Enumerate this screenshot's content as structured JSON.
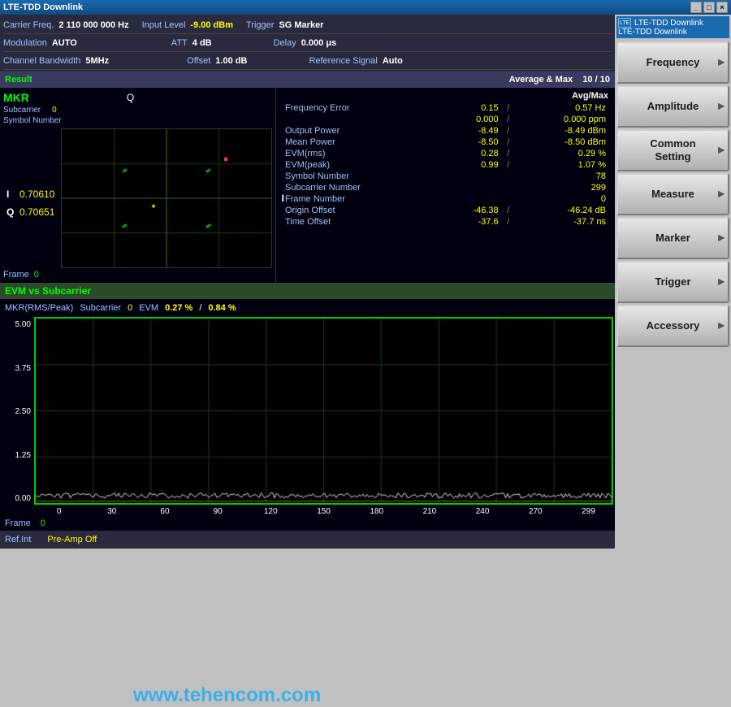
{
  "titlebar": {
    "title": "LTE-TDD Downlink",
    "controls": [
      "_",
      "□",
      "×"
    ]
  },
  "header": {
    "row1": {
      "carrier_freq_label": "Carrier Freq.",
      "carrier_freq_value": "2 110 000 000 Hz",
      "input_level_label": "Input Level",
      "input_level_value": "-9.00 dBm",
      "trigger_label": "Trigger",
      "trigger_value": "SG Marker"
    },
    "row2": {
      "modulation_label": "Modulation",
      "modulation_value": "AUTO",
      "att_label": "ATT",
      "att_value": "4 dB",
      "delay_label": "Delay",
      "delay_value": "0.000 μs"
    },
    "row3": {
      "channel_bw_label": "Channel Bandwidth",
      "channel_bw_value": "5MHz",
      "offset_label": "Offset",
      "offset_value": "1.00 dB",
      "ref_signal_label": "Reference Signal",
      "ref_signal_value": "Auto"
    }
  },
  "result_bar": {
    "left": "Result",
    "avg_max_label": "Average & Max",
    "avg_max_val1": "10",
    "avg_max_sep": "/",
    "avg_max_val2": "10"
  },
  "mkr": {
    "title": "MKR",
    "q_label": "Q",
    "subcarrier_label": "Subcarrier",
    "subcarrier_val": "0",
    "symbol_number_label": "Symbol Number",
    "i_label": "I",
    "i_val": "0.70610",
    "q_label2": "Q",
    "q_val": "0.70651",
    "i_right": "I",
    "frame_label": "Frame",
    "frame_val": "0"
  },
  "measurements": {
    "avg_max_col": "Avg/Max",
    "frequency_error": {
      "label": "Frequency Error",
      "val1": "0.15",
      "sep": "/",
      "val2": "0.57 Hz",
      "val3": "0.000",
      "val4": "0.000 ppm"
    },
    "output_power": {
      "label": "Output Power",
      "val1": "-8.49",
      "sep": "/",
      "val2": "-8.49 dBm"
    },
    "mean_power": {
      "label": "Mean Power",
      "val1": "-8.50",
      "sep": "/",
      "val2": "-8.50 dBm"
    },
    "evm_rms": {
      "label": "EVM(rms)",
      "val1": "0.28",
      "sep": "/",
      "val2": "0.29 %"
    },
    "evm_peak": {
      "label": "EVM(peak)",
      "val1": "0.99",
      "sep": "/",
      "val2": "1.07 %"
    },
    "symbol_number": {
      "label": "Symbol Number",
      "val": "78"
    },
    "subcarrier_number": {
      "label": "Subcarrier Number",
      "val": "299"
    },
    "frame_number": {
      "label": "Frame Number",
      "val": "0"
    },
    "origin_offset": {
      "label": "Origin Offset",
      "val1": "-46.38",
      "sep": "/",
      "val2": "-46.24 dB"
    },
    "time_offset": {
      "label": "Time Offset",
      "val1": "-37.6",
      "sep": "/",
      "val2": "-37.7 ns"
    }
  },
  "evm_section": {
    "title": "EVM vs Subcarrier",
    "marker_label": "MKR(RMS/Peak)",
    "subcarrier_label": "Subcarrier",
    "subcarrier_val": "0",
    "evm_label": "EVM",
    "evm_val1": "0.27 %",
    "evm_sep": "/",
    "evm_val2": "0.84 %",
    "y_axis": [
      "5.00",
      "3.75",
      "2.50",
      "1.25",
      "0.00"
    ],
    "x_axis": [
      "0",
      "30",
      "60",
      "90",
      "120",
      "150",
      "180",
      "210",
      "240",
      "270",
      "299"
    ],
    "frame_label": "Frame",
    "frame_val": "0"
  },
  "bottom_bar": {
    "ref_int_label": "Ref.Int",
    "pre_amp_label": "Pre-Amp Off"
  },
  "sidebar": {
    "title1": "LTE-TDD Downlink",
    "title2": "LTE-TDD Downlink",
    "buttons": [
      {
        "label": "Frequency",
        "id": "frequency"
      },
      {
        "label": "Amplitude",
        "id": "amplitude"
      },
      {
        "label": "Common\nSetting",
        "id": "common-setting"
      },
      {
        "label": "Measure",
        "id": "measure"
      },
      {
        "label": "Marker",
        "id": "marker"
      },
      {
        "label": "Trigger",
        "id": "trigger"
      },
      {
        "label": "Accessory",
        "id": "accessory"
      }
    ]
  },
  "watermark": "www.tehencom.com"
}
